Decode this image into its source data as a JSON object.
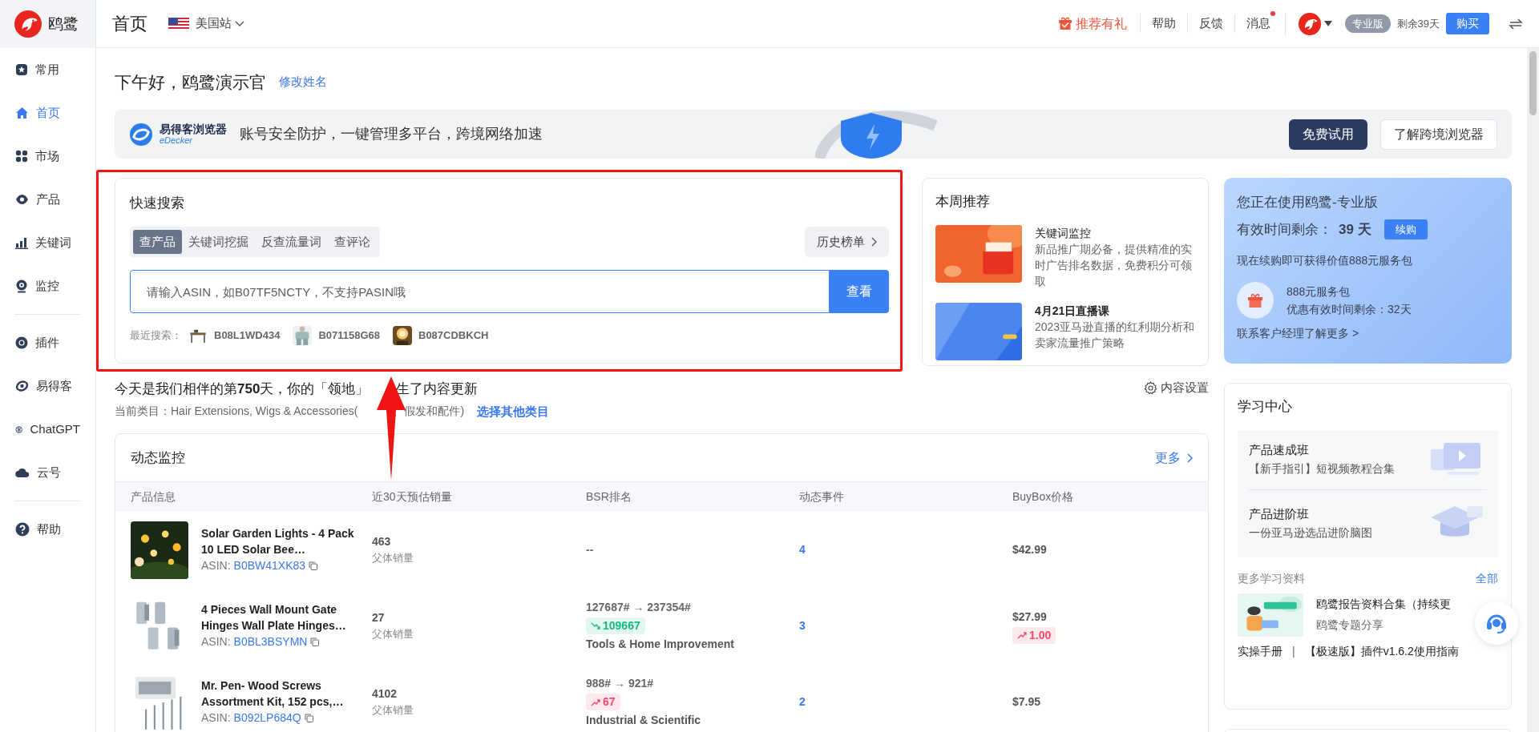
{
  "brand": {
    "name": "鸥鹭"
  },
  "sidebar": {
    "items": [
      {
        "label": "常用",
        "selected": false
      },
      {
        "label": "首页",
        "selected": true
      },
      {
        "label": "市场",
        "selected": false
      },
      {
        "label": "产品",
        "selected": false
      },
      {
        "label": "关键词",
        "selected": false
      },
      {
        "label": "监控",
        "selected": false
      },
      {
        "label": "插件",
        "selected": false,
        "divider_before": true
      },
      {
        "label": "易得客",
        "selected": false
      },
      {
        "label": "ChatGPT",
        "selected": false
      },
      {
        "label": "云号",
        "selected": false
      },
      {
        "label": "帮助",
        "selected": false,
        "divider_before": true
      }
    ]
  },
  "header": {
    "title": "首页",
    "site": "美国站",
    "referral": "推荐有礼",
    "links": [
      {
        "label": "帮助",
        "dot": false
      },
      {
        "label": "反馈",
        "dot": false
      },
      {
        "label": "消息",
        "dot": true
      }
    ],
    "plan": "专业版",
    "remaining": "剩余39天",
    "buy": "购买"
  },
  "greeting": {
    "text": "下午好，鸥鹭演示官",
    "edit_link": "修改姓名"
  },
  "banner": {
    "logo_title": "易得客浏览器",
    "logo_sub": "eDecker",
    "slogan": "账号安全防护，一键管理多平台，跨境网络加速",
    "primary": "免费试用",
    "secondary": "了解跨境浏览器"
  },
  "quick_search": {
    "title": "快速搜索",
    "tabs": [
      {
        "label": "查产品",
        "selected": true
      },
      {
        "label": "关键词挖掘",
        "selected": false
      },
      {
        "label": "反查流量词",
        "selected": false
      },
      {
        "label": "查评论",
        "selected": false
      }
    ],
    "history": "历史榜单",
    "placeholder": "请输入ASIN，如B07TF5NCTY，不支持PASIN哦",
    "submit": "查看",
    "recent_label": "最近搜索：",
    "recent": [
      "B08L1WD434",
      "B071158G68",
      "B087CDBKCH"
    ]
  },
  "weekly": {
    "title": "本周推荐",
    "items": [
      {
        "title": "关键词监控",
        "desc": "新品推广期必备，提供精准的实时广告排名数据，免费积分可领取"
      },
      {
        "title": "4月21日直播课",
        "desc": "2023亚马逊直播的红利期分析和卖家流量推广策略"
      }
    ]
  },
  "plan_card": {
    "title": "您正在使用鸥鹭-专业版",
    "remaining_label": "有效时间剩余：",
    "remaining_value": "39 天",
    "renew": "续购",
    "offer": "现在续购即可获得价值888元服务包",
    "package_title": "888元服务包",
    "package_remaining": "优惠有效时间剩余：32天",
    "contact": "联系客户经理了解更多 >"
  },
  "today": {
    "text_before": "今天是我们相伴的第**750**天，你的「领地」",
    "text_after": "生了内容更新",
    "category_label": "当前类目：Hair Extensions, Wigs & Accessories(",
    "category_after": "、假发和配件)",
    "category_link": "选择其他类目",
    "settings": "内容设置"
  },
  "monitor": {
    "title": "动态监控",
    "more": "更多",
    "columns": [
      "产品信息",
      "近30天预估销量",
      "BSR排名",
      "动态事件",
      "BuyBox价格"
    ],
    "rows": [
      {
        "title": "Solar Garden Lights - 4 Pack 10 LED Solar Bee…",
        "asin_label": "ASIN:",
        "asin": "B0BW41XK83",
        "sales": "463",
        "sales_note": "父体销量",
        "bsr": "--",
        "events": "4",
        "price": "$42.99"
      },
      {
        "title": "4 Pieces Wall Mount Gate Hinges Wall Plate Hinges…",
        "asin_label": "ASIN:",
        "asin": "B0BL3BSYMN",
        "sales": "27",
        "sales_note": "父体销量",
        "bsr": "127687# → 237354#",
        "bsr_change": {
          "kind": "down",
          "value": "109667"
        },
        "bsr_category": "Tools & Home Improvement",
        "events": "3",
        "price": "$27.99",
        "price_change": {
          "kind": "up",
          "value": "1.00"
        }
      },
      {
        "title": "Mr. Pen- Wood Screws Assortment Kit, 152 pcs,…",
        "asin_label": "ASIN:",
        "asin": "B092LP684Q",
        "sales": "4102",
        "sales_note": "父体销量",
        "bsr": "988# → 921#",
        "bsr_change": {
          "kind": "up",
          "value": "67"
        },
        "bsr_category": "Industrial & Scientific",
        "events": "2",
        "price": "$7.95"
      }
    ]
  },
  "learning": {
    "title": "学习中心",
    "courses": [
      {
        "title": "产品速成班",
        "desc": "【新手指引】短视频教程合集"
      },
      {
        "title": "产品进阶班",
        "desc": "一份亚马逊选品进阶脑图"
      }
    ],
    "more_label": "更多学习资料",
    "all": "全部",
    "resource_title": "鸥鹭报告资料合集（持续更",
    "resource_sub": "鸥鹭专题分享",
    "links": [
      "实操手册",
      "【极速版】插件v1.6.2使用指南"
    ],
    "separator": "|"
  },
  "annotations": {
    "frame": true,
    "arrow": true
  }
}
